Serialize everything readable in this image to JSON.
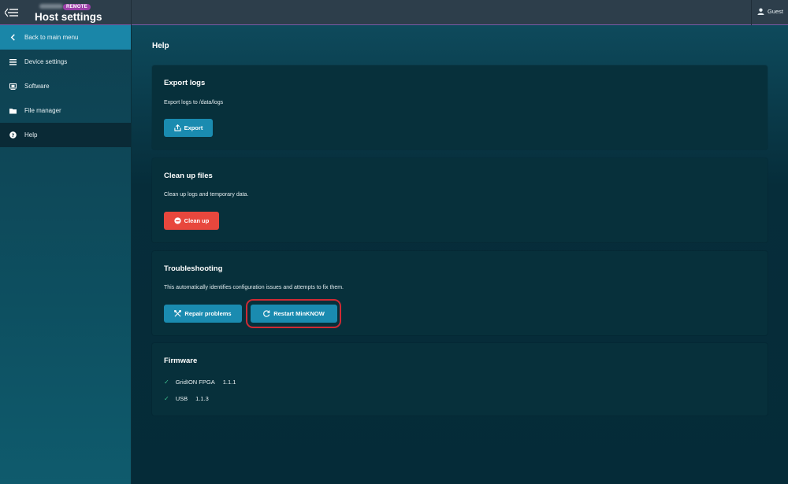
{
  "header": {
    "badge": "REMOTE",
    "title": "Host settings",
    "user": "Guest"
  },
  "sidebar": {
    "items": [
      {
        "label": "Back to main menu",
        "icon": "chevron-left-icon"
      },
      {
        "label": "Device settings",
        "icon": "list-icon"
      },
      {
        "label": "Software",
        "icon": "monitor-icon"
      },
      {
        "label": "File manager",
        "icon": "folder-icon"
      },
      {
        "label": "Help",
        "icon": "question-circle-icon"
      }
    ]
  },
  "main": {
    "title": "Help",
    "export": {
      "title": "Export logs",
      "description": "Export logs to /data/logs",
      "button": "Export"
    },
    "cleanup": {
      "title": "Clean up files",
      "description": "Clean up logs and temporary data.",
      "button": "Clean up"
    },
    "troubleshooting": {
      "title": "Troubleshooting",
      "description": "This automatically identifies configuration issues and attempts to fix them.",
      "repair_button": "Repair problems",
      "restart_button": "Restart MinKNOW"
    },
    "firmware": {
      "title": "Firmware",
      "items": [
        {
          "name": "GridION FPGA",
          "version": "1.1.1"
        },
        {
          "name": "USB",
          "version": "1.1.3"
        }
      ]
    }
  },
  "colors": {
    "accent": "#1a8bb0",
    "danger": "#e8473d",
    "highlight": "#d02a34",
    "check": "#3fbf8f"
  }
}
